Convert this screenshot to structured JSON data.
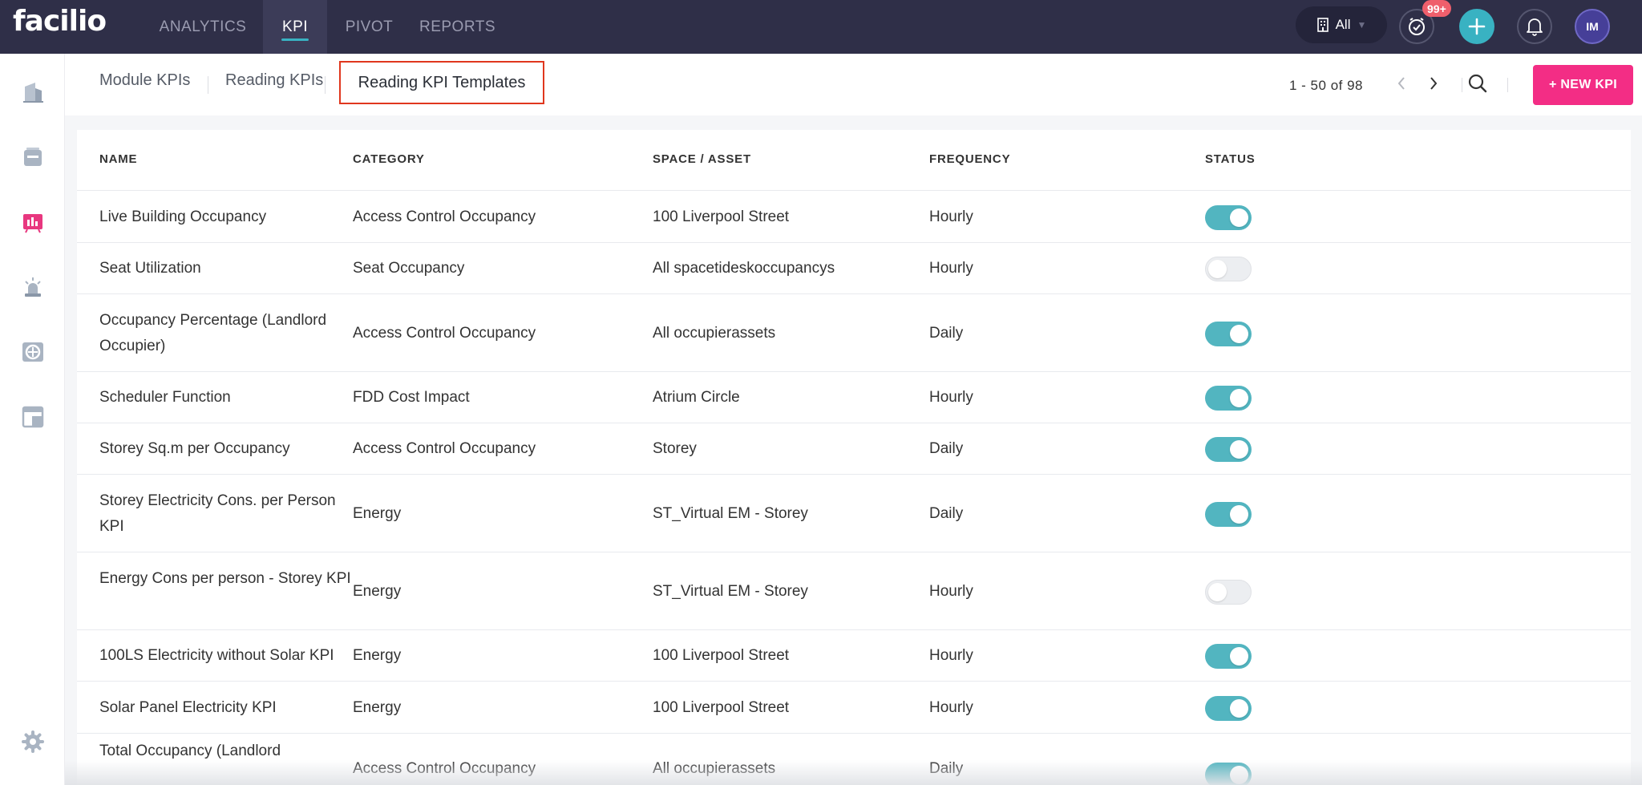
{
  "app": {
    "logo": "facilio"
  },
  "top_nav": [
    {
      "label": "ANALYTICS",
      "active": false
    },
    {
      "label": "KPI",
      "active": true
    },
    {
      "label": "PIVOT",
      "active": false
    },
    {
      "label": "REPORTS",
      "active": false
    }
  ],
  "header": {
    "site_selector": "All",
    "notification_badge": "99+",
    "avatar_initials": "IM"
  },
  "colors": {
    "accent": "#39b2c2",
    "brand_pink": "#f32d85",
    "topbar": "#2f2f48",
    "toggle_on": "#52b5c0",
    "highlight_border": "#e0371e"
  },
  "sidebar_icons": [
    "building-icon",
    "inbox-icon",
    "dashboard-icon",
    "alarm-icon",
    "asset-icon",
    "workspace-icon",
    "settings-icon"
  ],
  "sub_tabs": [
    {
      "label": "Module KPIs",
      "active": false
    },
    {
      "label": "Reading KPIs",
      "active": false
    },
    {
      "label": "Reading KPI Templates",
      "active": true
    }
  ],
  "pagination": {
    "text": "1 - 50 of 98"
  },
  "new_kpi_button": "+ NEW KPI",
  "table": {
    "columns": [
      "NAME",
      "CATEGORY",
      "SPACE / ASSET",
      "FREQUENCY",
      "STATUS"
    ],
    "rows": [
      {
        "name": "Live Building Occupancy",
        "category": "Access Control Occupancy",
        "space": "100 Liverpool Street",
        "frequency": "Hourly",
        "status": true
      },
      {
        "name": "Seat Utilization",
        "category": "Seat Occupancy",
        "space": "All spacetideskoccupancys",
        "frequency": "Hourly",
        "status": false
      },
      {
        "name": "Occupancy Percentage (Landlord Occupier)",
        "category": "Access Control Occupancy",
        "space": "All occupierassets",
        "frequency": "Daily",
        "status": true
      },
      {
        "name": "Scheduler Function",
        "category": "FDD Cost Impact",
        "space": "Atrium Circle",
        "frequency": "Hourly",
        "status": true
      },
      {
        "name": "Storey Sq.m per Occupancy",
        "category": "Access Control Occupancy",
        "space": "Storey",
        "frequency": "Daily",
        "status": true
      },
      {
        "name": "Storey Electricity Cons. per Person KPI",
        "category": "Energy",
        "space": "ST_Virtual EM - Storey",
        "frequency": "Daily",
        "status": true
      },
      {
        "name": "Energy Cons per person - Storey KPI",
        "category": "Energy",
        "space": "ST_Virtual EM - Storey",
        "frequency": "Hourly",
        "status": false
      },
      {
        "name": "100LS Electricity without Solar KPI",
        "category": "Energy",
        "space": "100 Liverpool Street",
        "frequency": "Hourly",
        "status": true
      },
      {
        "name": "Solar Panel Electricity KPI",
        "category": "Energy",
        "space": "100 Liverpool Street",
        "frequency": "Hourly",
        "status": true
      },
      {
        "name": "Total Occupancy (Landlord",
        "category": "Access Control Occupancy",
        "space": "All occupierassets",
        "frequency": "Daily",
        "status": true
      }
    ]
  }
}
